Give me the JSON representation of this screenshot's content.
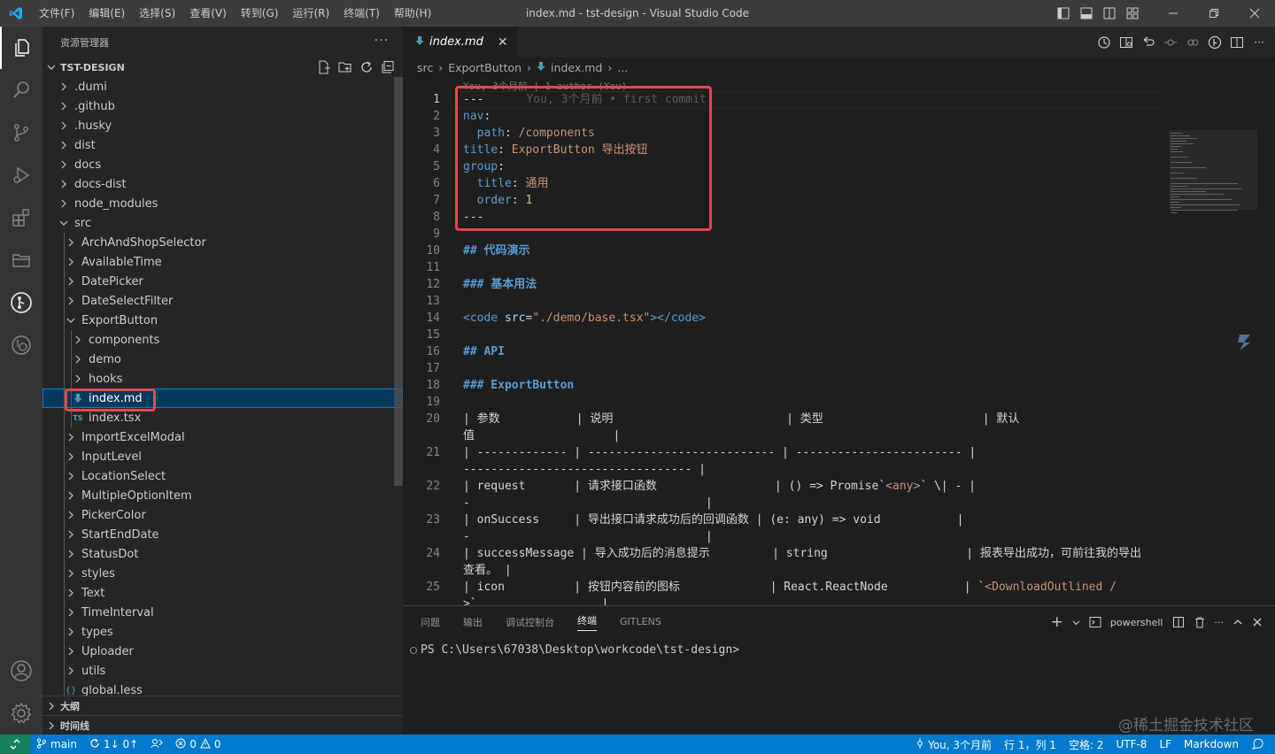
{
  "window": {
    "title": "index.md - tst-design - Visual Studio Code",
    "menus": [
      "文件(F)",
      "编辑(E)",
      "选择(S)",
      "查看(V)",
      "转到(G)",
      "运行(R)",
      "终端(T)",
      "帮助(H)"
    ]
  },
  "sidebar": {
    "title": "资源管理器",
    "more": "···",
    "root": "TST-DESIGN",
    "items": [
      {
        "label": ".dumi",
        "depth": 0,
        "type": "folder"
      },
      {
        "label": ".github",
        "depth": 0,
        "type": "folder"
      },
      {
        "label": ".husky",
        "depth": 0,
        "type": "folder"
      },
      {
        "label": "dist",
        "depth": 0,
        "type": "folder"
      },
      {
        "label": "docs",
        "depth": 0,
        "type": "folder"
      },
      {
        "label": "docs-dist",
        "depth": 0,
        "type": "folder"
      },
      {
        "label": "node_modules",
        "depth": 0,
        "type": "folder"
      },
      {
        "label": "src",
        "depth": 0,
        "type": "folder-open"
      },
      {
        "label": "ArchAndShopSelector",
        "depth": 1,
        "type": "folder"
      },
      {
        "label": "AvailableTime",
        "depth": 1,
        "type": "folder"
      },
      {
        "label": "DatePicker",
        "depth": 1,
        "type": "folder"
      },
      {
        "label": "DateSelectFilter",
        "depth": 1,
        "type": "folder"
      },
      {
        "label": "ExportButton",
        "depth": 1,
        "type": "folder-open"
      },
      {
        "label": "components",
        "depth": 2,
        "type": "folder"
      },
      {
        "label": "demo",
        "depth": 2,
        "type": "folder"
      },
      {
        "label": "hooks",
        "depth": 2,
        "type": "folder"
      },
      {
        "label": "index.md",
        "depth": 2,
        "type": "md",
        "selected": true
      },
      {
        "label": "index.tsx",
        "depth": 2,
        "type": "ts"
      },
      {
        "label": "ImportExcelModal",
        "depth": 1,
        "type": "folder"
      },
      {
        "label": "InputLevel",
        "depth": 1,
        "type": "folder"
      },
      {
        "label": "LocationSelect",
        "depth": 1,
        "type": "folder"
      },
      {
        "label": "MultipleOptionItem",
        "depth": 1,
        "type": "folder"
      },
      {
        "label": "PickerColor",
        "depth": 1,
        "type": "folder"
      },
      {
        "label": "StartEndDate",
        "depth": 1,
        "type": "folder"
      },
      {
        "label": "StatusDot",
        "depth": 1,
        "type": "folder"
      },
      {
        "label": "styles",
        "depth": 1,
        "type": "folder"
      },
      {
        "label": "Text",
        "depth": 1,
        "type": "folder"
      },
      {
        "label": "TimeInterval",
        "depth": 1,
        "type": "folder"
      },
      {
        "label": "types",
        "depth": 1,
        "type": "folder"
      },
      {
        "label": "Uploader",
        "depth": 1,
        "type": "folder"
      },
      {
        "label": "utils",
        "depth": 1,
        "type": "folder"
      },
      {
        "label": "global.less",
        "depth": 1,
        "type": "less"
      }
    ],
    "outline": "大纲",
    "timeline": "时间线"
  },
  "editor": {
    "tab": "index.md",
    "breadcrumb": [
      "src",
      "ExportButton",
      "index.md",
      "..."
    ],
    "blame_top": "You, 3个月前 | 1 author (You)",
    "inline_blame": "You, 3个月前 • first commit",
    "lines": [
      {
        "n": "1",
        "segs": [
          [
            "---",
            ""
          ]
        ]
      },
      {
        "n": "2",
        "segs": [
          [
            "nav",
            "k"
          ],
          [
            ":",
            ""
          ]
        ]
      },
      {
        "n": "3",
        "segs": [
          [
            "  path",
            "k"
          ],
          [
            ": ",
            ""
          ],
          [
            "/components",
            "s"
          ]
        ]
      },
      {
        "n": "4",
        "segs": [
          [
            "title",
            "k"
          ],
          [
            ": ",
            ""
          ],
          [
            "ExportButton 导出按钮",
            "s"
          ]
        ]
      },
      {
        "n": "5",
        "segs": [
          [
            "group",
            "k"
          ],
          [
            ":",
            ""
          ]
        ]
      },
      {
        "n": "6",
        "segs": [
          [
            "  title",
            "k"
          ],
          [
            ": ",
            ""
          ],
          [
            "通用",
            "s"
          ]
        ]
      },
      {
        "n": "7",
        "segs": [
          [
            "  order",
            "k"
          ],
          [
            ": ",
            ""
          ],
          [
            "1",
            "n"
          ]
        ]
      },
      {
        "n": "8",
        "segs": [
          [
            "---",
            ""
          ]
        ]
      },
      {
        "n": "9",
        "segs": []
      },
      {
        "n": "10",
        "segs": [
          [
            "## 代码演示",
            "h"
          ]
        ]
      },
      {
        "n": "11",
        "segs": []
      },
      {
        "n": "12",
        "segs": [
          [
            "### 基本用法",
            "h"
          ]
        ]
      },
      {
        "n": "13",
        "segs": []
      },
      {
        "n": "14",
        "segs": [
          [
            "<code ",
            "tag"
          ],
          [
            "src",
            "attr"
          ],
          [
            "=",
            ""
          ],
          [
            "\"./demo/base.tsx\"",
            "s"
          ],
          [
            "></code>",
            "tag"
          ]
        ]
      },
      {
        "n": "15",
        "segs": []
      },
      {
        "n": "16",
        "segs": [
          [
            "## API",
            "h"
          ]
        ]
      },
      {
        "n": "17",
        "segs": []
      },
      {
        "n": "18",
        "segs": [
          [
            "### ExportButton",
            "h"
          ]
        ]
      },
      {
        "n": "19",
        "segs": []
      },
      {
        "n": "20",
        "segs": [
          [
            "| 参数           | 说明                         | 类型                       | 默认",
            ""
          ]
        ]
      },
      {
        "n": "",
        "segs": [
          [
            "值                    |",
            ""
          ]
        ]
      },
      {
        "n": "21",
        "segs": [
          [
            "| ------------- | --------------------------- | ------------------------ |",
            ""
          ]
        ]
      },
      {
        "n": "",
        "segs": [
          [
            "--------------------------------- |",
            ""
          ]
        ]
      },
      {
        "n": "22",
        "segs": [
          [
            "| request       | 请求接口函数                 | () => Promise`",
            ""
          ],
          [
            "<any>",
            "s"
          ],
          [
            "` \\| - |",
            ""
          ]
        ]
      },
      {
        "n": "",
        "segs": [
          [
            "-                                  |",
            ""
          ]
        ]
      },
      {
        "n": "23",
        "segs": [
          [
            "| onSuccess     | 导出接口请求成功后的回调函数 | (e: any) => void           |",
            ""
          ]
        ]
      },
      {
        "n": "",
        "segs": [
          [
            "-                                  |",
            ""
          ]
        ]
      },
      {
        "n": "24",
        "segs": [
          [
            "| successMessage | 导入成功后的消息提示         | string                    | 报表导出成功，可前往我的导出",
            ""
          ]
        ]
      },
      {
        "n": "",
        "segs": [
          [
            "查看。 |",
            ""
          ]
        ]
      },
      {
        "n": "25",
        "segs": [
          [
            "| icon          | 按钮内容前的图标             | React.ReactNode           | `",
            ""
          ],
          [
            "<DownloadOutlined /",
            "s"
          ]
        ]
      },
      {
        "n": "",
        "segs": [
          [
            ">`                  |",
            ""
          ]
        ]
      }
    ]
  },
  "panel": {
    "tabs": [
      "问题",
      "输出",
      "调试控制台",
      "终端",
      "GITLENS"
    ],
    "active_tab": "终端",
    "shell": "powershell",
    "prompt": "PS C:\\Users\\67038\\Desktop\\workcode\\tst-design>",
    "watermark": "@稀土掘金技术社区"
  },
  "statusbar": {
    "branch": "main",
    "sync": "1↓ 0↑",
    "errors": "0",
    "warnings": "0",
    "blame": "You, 3个月前",
    "position": "行 1，列 1",
    "indent": "空格: 2",
    "encoding": "UTF-8",
    "eol": "LF",
    "language": "Markdown"
  },
  "colors": {
    "accent": "#007acc",
    "highlight_box": "#e5484d",
    "selection": "#04395e"
  }
}
